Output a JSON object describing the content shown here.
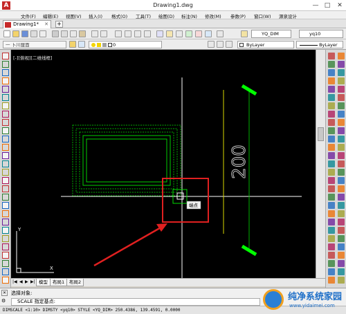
{
  "window": {
    "title": "Drawing1.dwg",
    "minimize": "—",
    "maximize": "□",
    "close": "✕"
  },
  "menus": [
    "文件(F)",
    "编辑(E)",
    "视图(V)",
    "插入(I)",
    "格式(O)",
    "工具(T)",
    "绘图(D)",
    "标注(N)",
    "修改(M)",
    "参数(P)",
    "窗口(W)",
    "源泉设计"
  ],
  "doc_tab": {
    "label": "Drawing1*",
    "close": "✕",
    "new": "+"
  },
  "toolbar": {
    "text_style": "YQ_DIM",
    "dim_style": "yq10"
  },
  "layers": {
    "layer_filter": "一 卜川厘面",
    "current_layer": "0",
    "color": "ByLayer",
    "linetype": "ByLayer"
  },
  "viewport": {
    "label": "[-][俯视][二维线框]"
  },
  "drawing": {
    "dimension_text": "200",
    "tooltip": "端点"
  },
  "layout_tabs": [
    "模型",
    "布局1",
    "布局2"
  ],
  "command": {
    "history": "选择对象:",
    "prompt": "SCALE 指定基点:"
  },
  "status": {
    "text": "DIMSCALE <1:10> DIMSTY <yq10> STYLE <YQ_DIM>  250.4386, 139.4591, 0.0000"
  },
  "watermark": {
    "title": "纯净系统家园",
    "url": "www.yidaimei.com"
  },
  "colors": {
    "canvas": "#000000",
    "dim_green": "#00e600",
    "highlight_red": "#e02020",
    "crosshair": "#ffffff"
  }
}
